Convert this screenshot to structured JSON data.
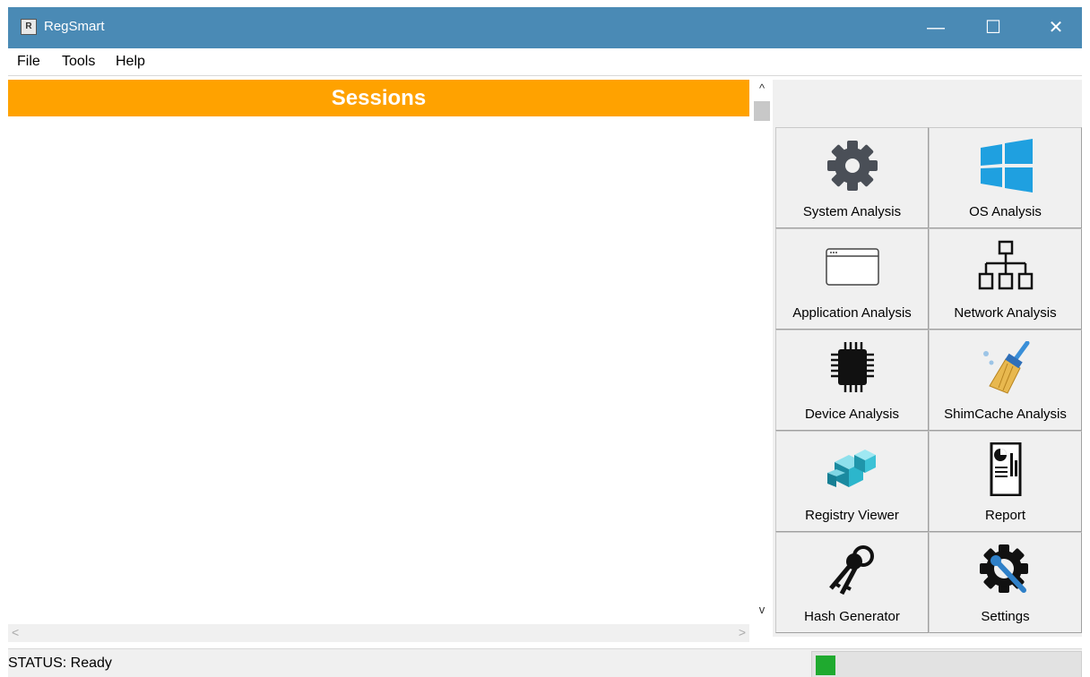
{
  "window": {
    "title": "RegSmart",
    "app_icon_text": "R",
    "controls": {
      "minimize": "—",
      "maximize": "☐",
      "close": "✕"
    }
  },
  "menu": {
    "items": [
      "File",
      "Tools",
      "Help"
    ]
  },
  "sessions": {
    "header": "Sessions"
  },
  "scroll": {
    "up": "^",
    "down": "v",
    "left": "<",
    "right": ">"
  },
  "tools": [
    {
      "label": "System Analysis",
      "icon": "gear-icon"
    },
    {
      "label": "OS Analysis",
      "icon": "windows-logo-icon"
    },
    {
      "label": "Application Analysis",
      "icon": "application-window-icon"
    },
    {
      "label": "Network Analysis",
      "icon": "network-tree-icon"
    },
    {
      "label": "Device Analysis",
      "icon": "chip-icon"
    },
    {
      "label": "ShimCache Analysis",
      "icon": "broom-icon"
    },
    {
      "label": "Registry Viewer",
      "icon": "registry-cubes-icon"
    },
    {
      "label": "Report",
      "icon": "report-document-icon"
    },
    {
      "label": "Hash Generator",
      "icon": "keys-icon"
    },
    {
      "label": "Settings",
      "icon": "settings-wrench-icon"
    }
  ],
  "status": {
    "text": "STATUS: Ready",
    "indicator_color": "#1faa2f"
  },
  "colors": {
    "titlebar": "#4a8ab5",
    "sessions_header": "#ffa200"
  }
}
